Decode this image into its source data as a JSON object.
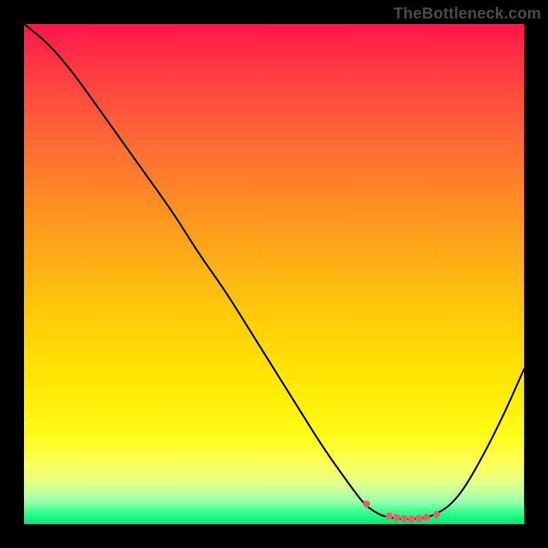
{
  "watermark": "TheBottleneck.com",
  "chart_data": {
    "type": "line",
    "title": "",
    "xlabel": "",
    "ylabel": "",
    "xlim": [
      0,
      100
    ],
    "ylim": [
      0,
      100
    ],
    "grid": false,
    "legend": false,
    "series": [
      {
        "name": "bottleneck-curve",
        "color": "#000000",
        "x": [
          0,
          5,
          10,
          15,
          20,
          25,
          30,
          35,
          40,
          45,
          50,
          55,
          60,
          65,
          68,
          70,
          72,
          75,
          78,
          80,
          82,
          85,
          88,
          92,
          96,
          100
        ],
        "values": [
          100,
          96,
          90,
          83,
          76,
          69,
          62,
          54,
          47,
          39,
          31,
          23,
          15,
          8,
          4,
          2.5,
          1.5,
          1.0,
          1.0,
          1.2,
          1.8,
          3.5,
          7,
          14,
          22,
          31
        ]
      },
      {
        "name": "marker-dots",
        "color": "#e06666",
        "type": "scatter",
        "x": [
          68.5,
          73.0,
          74.5,
          76.0,
          77.5,
          79.0,
          80.5,
          82.5
        ],
        "values": [
          4.0,
          1.6,
          1.3,
          1.1,
          1.0,
          1.1,
          1.3,
          1.9
        ]
      }
    ],
    "background_gradient": {
      "orientation": "vertical",
      "stops": [
        {
          "pos": 0.0,
          "color": "#ff154a"
        },
        {
          "pos": 0.35,
          "color": "#ff8b26"
        },
        {
          "pos": 0.72,
          "color": "#ffe904"
        },
        {
          "pos": 0.92,
          "color": "#e0ff8a"
        },
        {
          "pos": 1.0,
          "color": "#00e87a"
        }
      ]
    }
  }
}
